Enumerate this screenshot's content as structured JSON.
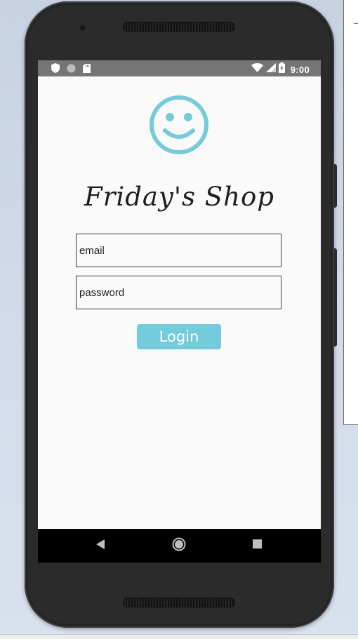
{
  "status_bar": {
    "time": "9:00",
    "left_icons": [
      "shield-icon",
      "circle-icon",
      "sd-card-icon"
    ],
    "right_icons": [
      "wifi-icon",
      "cell-signal-icon",
      "battery-charging-icon"
    ]
  },
  "app": {
    "logo_icon": "smiley-face-icon",
    "title": "Friday's Shop",
    "email_placeholder": "email",
    "password_placeholder": "password",
    "login_label": "Login"
  },
  "navigation_bar": {
    "buttons": [
      "back-icon",
      "home-icon",
      "recents-icon"
    ]
  },
  "colors": {
    "accent": "#74cbd9",
    "status_bar": "#757575",
    "screen_background": "#fafafa",
    "nav_bar": "#000000",
    "phone_body": "#2b2b2b"
  }
}
